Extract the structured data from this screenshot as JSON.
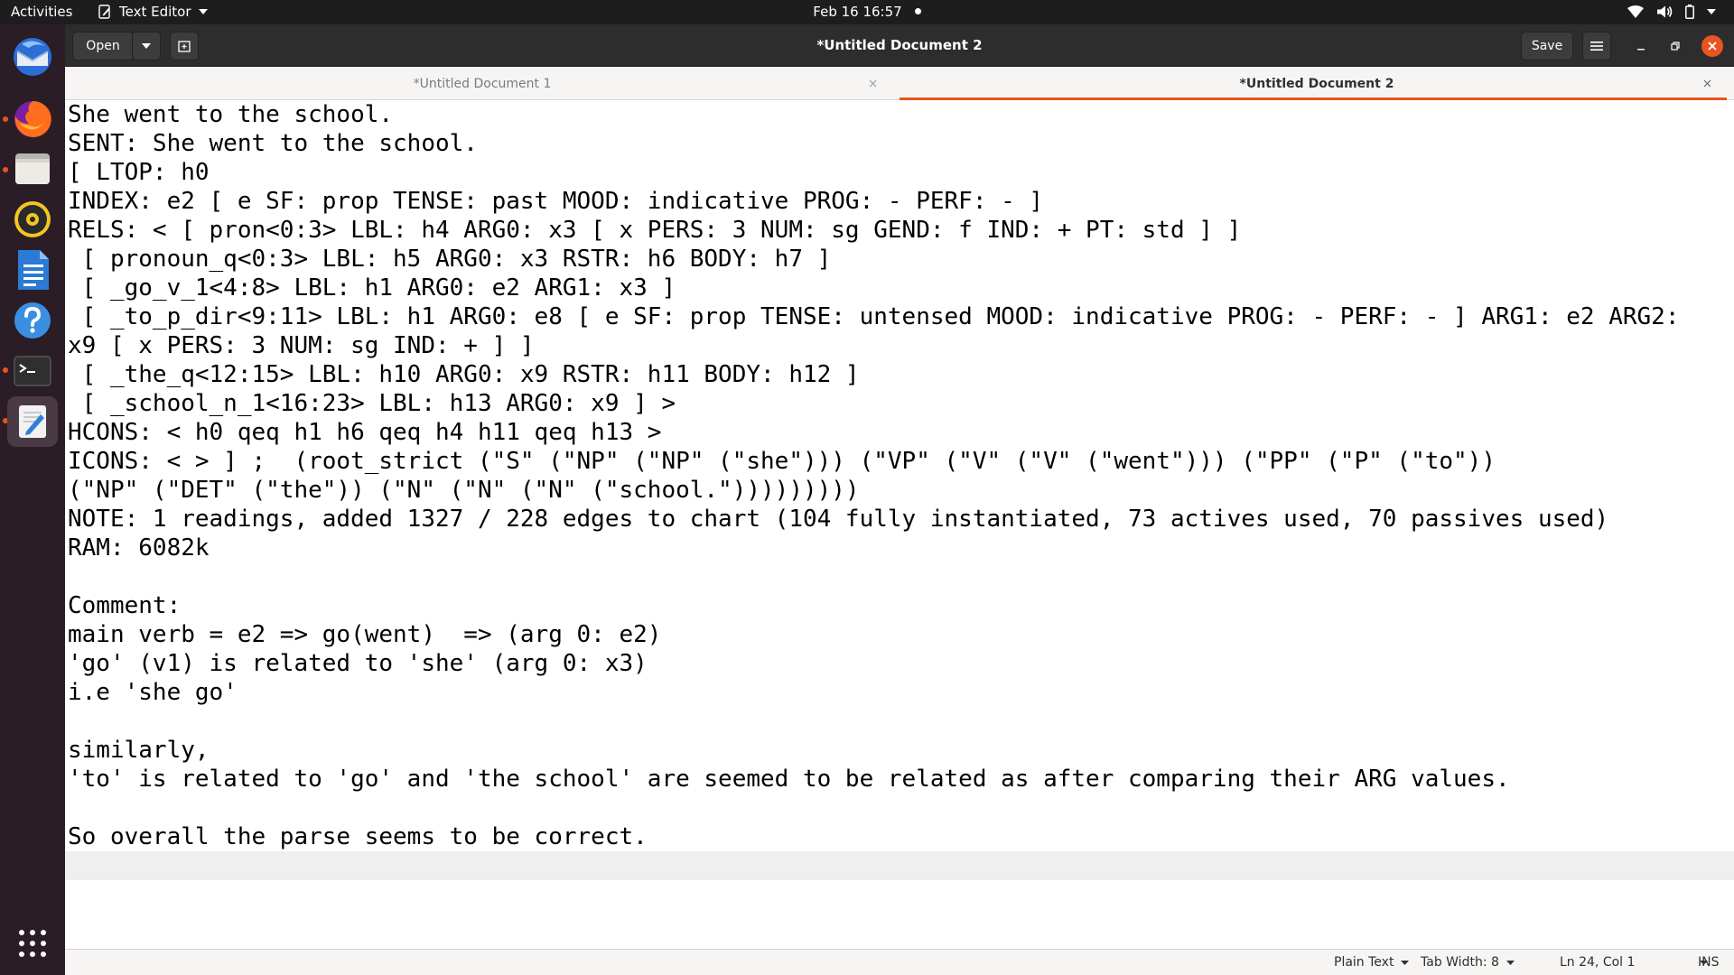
{
  "topbar": {
    "activities": "Activities",
    "app_name": "Text Editor",
    "clock": "Feb 16  16:57"
  },
  "dock": {
    "items": [
      {
        "name": "thunderbird-icon",
        "running": false
      },
      {
        "name": "firefox-icon",
        "running": true
      },
      {
        "name": "files-icon",
        "running": true
      },
      {
        "name": "rhythmbox-icon",
        "running": false
      },
      {
        "name": "writer-icon",
        "running": false
      },
      {
        "name": "help-icon",
        "running": false
      },
      {
        "name": "terminal-icon",
        "running": true
      },
      {
        "name": "text-editor-icon",
        "running": true
      }
    ]
  },
  "header": {
    "open_label": "Open",
    "title": "*Untitled Document 2",
    "save_label": "Save"
  },
  "tabs": [
    {
      "label": "*Untitled Document 1",
      "active": false
    },
    {
      "label": "*Untitled Document 2",
      "active": true
    }
  ],
  "editor": {
    "lines": [
      "She went to the school.",
      "SENT: She went to the school.",
      "[ LTOP: h0",
      "INDEX: e2 [ e SF: prop TENSE: past MOOD: indicative PROG: - PERF: - ]",
      "RELS: < [ pron<0:3> LBL: h4 ARG0: x3 [ x PERS: 3 NUM: sg GEND: f IND: + PT: std ] ]",
      " [ pronoun_q<0:3> LBL: h5 ARG0: x3 RSTR: h6 BODY: h7 ]",
      " [ _go_v_1<4:8> LBL: h1 ARG0: e2 ARG1: x3 ]",
      " [ _to_p_dir<9:11> LBL: h1 ARG0: e8 [ e SF: prop TENSE: untensed MOOD: indicative PROG: - PERF: - ] ARG1: e2 ARG2:",
      "x9 [ x PERS: 3 NUM: sg IND: + ] ]",
      " [ _the_q<12:15> LBL: h10 ARG0: x9 RSTR: h11 BODY: h12 ]",
      " [ _school_n_1<16:23> LBL: h13 ARG0: x9 ] >",
      "HCONS: < h0 qeq h1 h6 qeq h4 h11 qeq h13 >",
      "ICONS: < > ] ;  (root_strict (\"S\" (\"NP\" (\"NP\" (\"she\"))) (\"VP\" (\"V\" (\"V\" (\"went\"))) (\"PP\" (\"P\" (\"to\"))",
      "(\"NP\" (\"DET\" (\"the\")) (\"N\" (\"N\" (\"N\" (\"school.\")))))))))",
      "NOTE: 1 readings, added 1327 / 228 edges to chart (104 fully instantiated, 73 actives used, 70 passives used)",
      "RAM: 6082k",
      "",
      "Comment:",
      "main verb = e2 => go(went)  => (arg 0: e2)",
      "'go' (v1) is related to 'she' (arg 0: x3)",
      "i.e 'she go'",
      "",
      "similarly,",
      "'to' is related to 'go' and 'the school' are seemed to be related as after comparing their ARG values.",
      "",
      "So overall the parse seems to be correct.",
      ""
    ],
    "current_line_index": 26
  },
  "statusbar": {
    "language": "Plain Text",
    "tab_width": "Tab Width: 8",
    "position": "Ln 24, Col 1",
    "mode": "INS"
  },
  "colors": {
    "accent": "#e95420",
    "dock_bg": "#2b1d26",
    "topbar_bg": "#1d1d1d",
    "headerbar_bg": "#2d2d2d"
  }
}
